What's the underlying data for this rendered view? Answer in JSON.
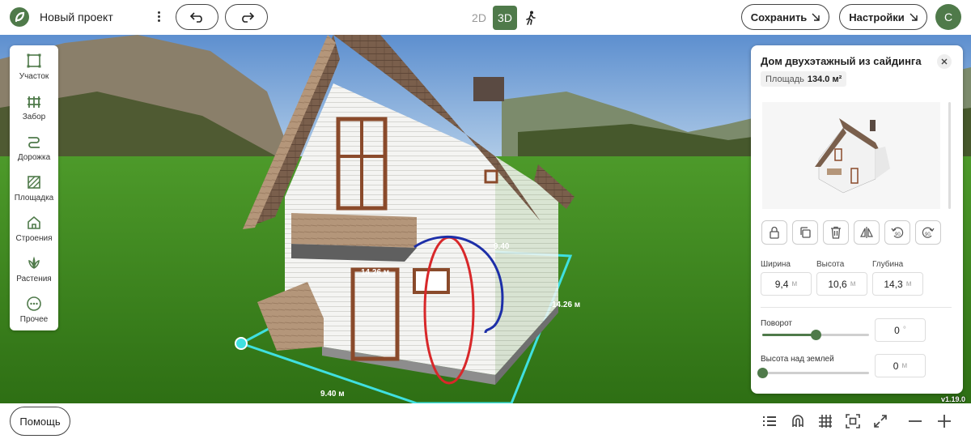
{
  "header": {
    "project_name": "Новый проект",
    "mode_2d": "2D",
    "mode_3d": "3D",
    "save_label": "Сохранить",
    "settings_label": "Настройки",
    "avatar_letter": "С",
    "active_mode": "3D"
  },
  "left_tools": [
    {
      "label": "Участок",
      "icon": "plot-icon"
    },
    {
      "label": "Забор",
      "icon": "fence-icon"
    },
    {
      "label": "Дорожка",
      "icon": "path-icon"
    },
    {
      "label": "Площадка",
      "icon": "platform-icon"
    },
    {
      "label": "Строения",
      "icon": "building-icon"
    },
    {
      "label": "Растения",
      "icon": "plant-icon"
    },
    {
      "label": "Прочее",
      "icon": "more-icon"
    }
  ],
  "scene": {
    "dim_width": "9.40 м",
    "dim_depth": "14.26 м",
    "dim_top_width": "9.40",
    "dim_inner_depth": "14.26 м"
  },
  "panel": {
    "title": "Дом двухэтажный из сайдинга",
    "area_label": "Площадь",
    "area_value": "134.0 м²",
    "fields": {
      "width_label": "Ширина",
      "width_value": "9,4",
      "height_label": "Высота",
      "height_value": "10,6",
      "depth_label": "Глубина",
      "depth_value": "14,3",
      "unit": "м"
    },
    "rotation_label": "Поворот",
    "rotation_value": "0",
    "rotation_unit": "°",
    "rotation_fraction": 0.5,
    "elevation_label": "Высота над землей",
    "elevation_value": "0",
    "elevation_unit": "м",
    "elevation_fraction": 0.0
  },
  "version": "v1.19.0",
  "footer": {
    "help_label": "Помощь"
  },
  "colors": {
    "accent": "#4f7a4a",
    "measure": "#3fe0e0",
    "grass": "#3f8a1e"
  }
}
